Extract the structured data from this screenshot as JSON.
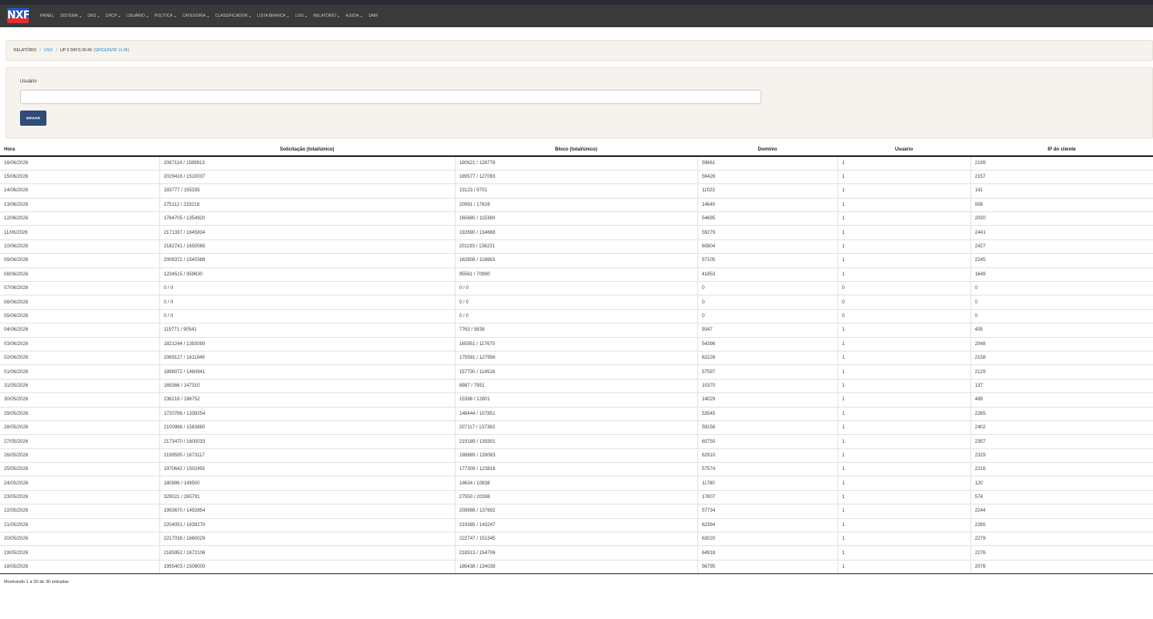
{
  "app": {
    "logo_text": "NXF",
    "brand_colors": {
      "logo_blue": "#2255cc",
      "logo_red": "#e03030",
      "topbar": "#3a3a3a",
      "primary_button": "#2f4d78",
      "link": "#2a86c8"
    }
  },
  "nav": {
    "items": [
      {
        "label": "PAINEL",
        "dropdown": false
      },
      {
        "label": "SISTEMA",
        "dropdown": true
      },
      {
        "label": "DNS",
        "dropdown": true
      },
      {
        "label": "DHCP",
        "dropdown": true
      },
      {
        "label": "USUÁRIO",
        "dropdown": true
      },
      {
        "label": "POLÍTICA",
        "dropdown": true
      },
      {
        "label": "CATEGORIA",
        "dropdown": true
      },
      {
        "label": "CLASSIFICADOR",
        "dropdown": true
      },
      {
        "label": "LISTA BRANCA",
        "dropdown": true
      },
      {
        "label": "LOG",
        "dropdown": true
      },
      {
        "label": "RELATÓRIO",
        "dropdown": true
      },
      {
        "label": "AJUDA",
        "dropdown": true
      },
      {
        "label": "SAIR",
        "dropdown": false
      }
    ]
  },
  "breadcrumb": {
    "root": "RELATÓRIO",
    "section": "USO",
    "current": "UP 9 DAYS 00:49",
    "since": "(SINCE06/06 11:45)"
  },
  "form": {
    "label": "Usuário",
    "value": "",
    "submit_label": "ENVIAR"
  },
  "table": {
    "columns": [
      "Hora",
      "Solicitação (total/único)",
      "Bloco (total/único)",
      "Domínio",
      "Usuário",
      "IP do cliente"
    ],
    "rows": [
      [
        "16/06/2026",
        "2087114 / 1589913",
        "180621 / 126776",
        "59661",
        "1",
        "2199"
      ],
      [
        "15/06/2026",
        "2029416 / 1510037",
        "189577 / 127093",
        "59426",
        "1",
        "2157"
      ],
      [
        "14/06/2026",
        "183777 / 155335",
        "13123 / 9701",
        "11023",
        "1",
        "141"
      ],
      [
        "13/06/2026",
        "275112 / 233218",
        "20991 / 17616",
        "14640",
        "1",
        "508"
      ],
      [
        "12/06/2026",
        "1764705 / 1354920",
        "165680 / 115389",
        "54695",
        "1",
        "2030"
      ],
      [
        "11/06/2026",
        "2171337 / 1645834",
        "192690 / 134668",
        "59279",
        "1",
        "2441"
      ],
      [
        "10/06/2026",
        "2182741 / 1650065",
        "201193 / 136231",
        "60804",
        "1",
        "2427"
      ],
      [
        "09/06/2026",
        "2006372 / 1540388",
        "162808 / 118663",
        "57105",
        "1",
        "2245"
      ],
      [
        "08/06/2026",
        "1234515 / 959630",
        "95561 / 70990",
        "41853",
        "1",
        "1649"
      ],
      [
        "07/06/2026",
        "0 / 0",
        "0 / 0",
        "0",
        "0",
        "0"
      ],
      [
        "06/06/2026",
        "0 / 0",
        "0 / 0",
        "0",
        "0",
        "0"
      ],
      [
        "05/06/2026",
        "0 / 0",
        "0 / 0",
        "0",
        "0",
        "0"
      ],
      [
        "04/06/2026",
        "115771 / 90541",
        "7763 / 5838",
        "9347",
        "1",
        "405"
      ],
      [
        "03/06/2026",
        "1821244 / 1393090",
        "165951 / 117670",
        "54396",
        "1",
        "2048"
      ],
      [
        "02/06/2026",
        "2069127 / 1611949",
        "175591 / 127956",
        "62226",
        "1",
        "2158"
      ],
      [
        "01/06/2026",
        "1898072 / 1460941",
        "157730 / 114518",
        "57597",
        "1",
        "2129"
      ],
      [
        "31/05/2026",
        "169366 / 147310",
        "8987 / 7951",
        "10370",
        "1",
        "137"
      ],
      [
        "30/05/2026",
        "236218 / 196752",
        "15398 / 12801",
        "14029",
        "1",
        "489"
      ],
      [
        "29/05/2026",
        "1720766 / 1339254",
        "148444 / 107851",
        "53545",
        "1",
        "2265"
      ],
      [
        "28/05/2026",
        "2100988 / 1583880",
        "207117 / 137383",
        "59156",
        "1",
        "2402"
      ],
      [
        "27/05/2026",
        "2173470 / 1600033",
        "219189 / 139301",
        "60750",
        "1",
        "2357"
      ],
      [
        "26/05/2026",
        "2199595 / 1673117",
        "198889 / 139083",
        "62910",
        "1",
        "2329"
      ],
      [
        "25/05/2026",
        "1970642 / 1502491",
        "177309 / 123816",
        "57574",
        "1",
        "2216"
      ],
      [
        "24/05/2026",
        "180886 / 149500",
        "14634 / 10838",
        "11760",
        "1",
        "120"
      ],
      [
        "23/05/2026",
        "329021 / 265791",
        "27550 / 20398",
        "17807",
        "1",
        "574"
      ],
      [
        "22/05/2026",
        "1993670 / 1492854",
        "208998 / 137692",
        "57734",
        "1",
        "2244"
      ],
      [
        "21/05/2026",
        "2204051 / 1639270",
        "219385 / 143247",
        "62394",
        "1",
        "2265"
      ],
      [
        "20/05/2026",
        "2217038 / 1660029",
        "222747 / 151345",
        "63020",
        "1",
        "2279"
      ],
      [
        "19/05/2026",
        "2185952 / 1672106",
        "218513 / 154706",
        "64918",
        "1",
        "2276"
      ],
      [
        "18/05/2026",
        "1955403 / 1508000",
        "186438 / 134038",
        "56795",
        "1",
        "2076"
      ]
    ],
    "info": "Mostrando 1 a 30 de 30 entradas"
  }
}
